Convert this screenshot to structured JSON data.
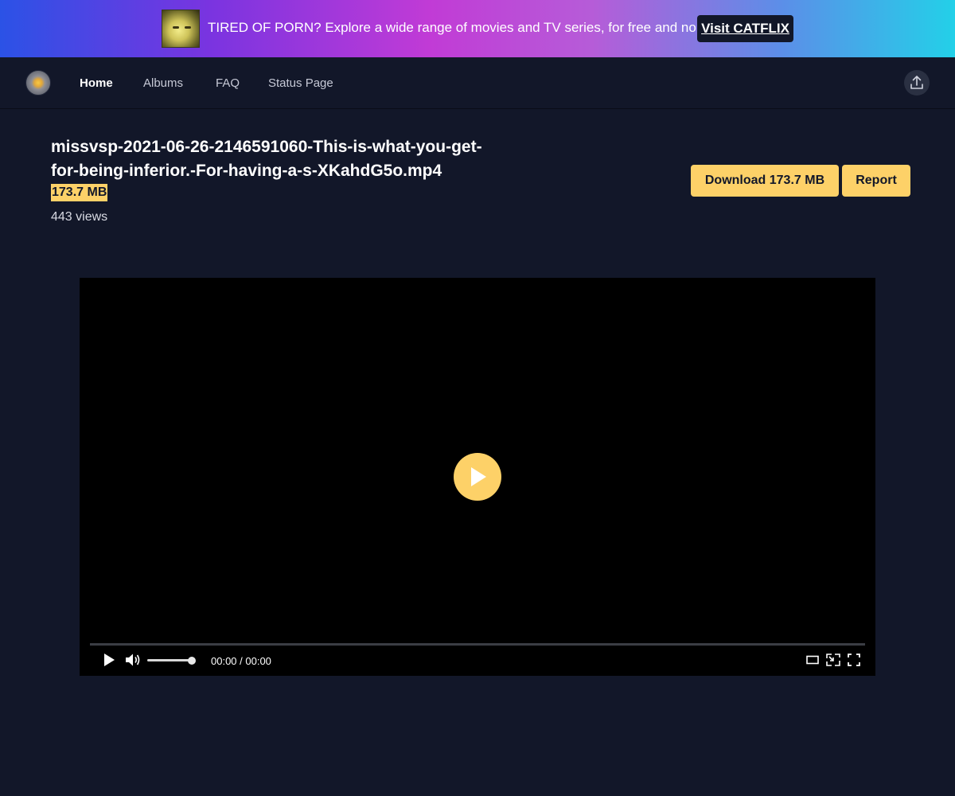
{
  "banner": {
    "text": "TIRED OF PORN? Explore a wide range of movies and TV series, for free and no ads.",
    "button_label": "Visit CATFLIX"
  },
  "nav": {
    "items": [
      {
        "label": "Home",
        "active": true
      },
      {
        "label": "Albums",
        "active": false
      },
      {
        "label": "FAQ",
        "active": false
      },
      {
        "label": "Status Page",
        "active": false
      }
    ]
  },
  "file": {
    "title": "missvsp-2021-06-26-2146591060-This-is-what-you-get-for-being-inferior.-For-having-a-s-XKahdG5o.mp4",
    "size": "173.7 MB",
    "views": "443 views"
  },
  "actions": {
    "download_label": "Download 173.7 MB",
    "report_label": "Report"
  },
  "player": {
    "time": "00:00 / 00:00",
    "volume": 1.0,
    "progress": 0
  },
  "colors": {
    "accent": "#fdd168",
    "background": "#121729"
  }
}
